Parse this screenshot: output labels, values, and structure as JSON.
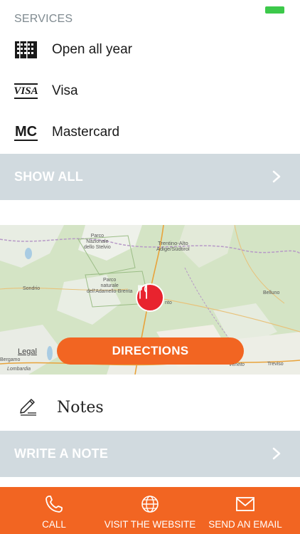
{
  "status_bar": {
    "battery_color": "#3cc94a"
  },
  "services": {
    "title": "SERVICES",
    "items": [
      {
        "icon": "calendar-icon",
        "label": "Open all year"
      },
      {
        "icon": "visa-icon",
        "label": "Visa",
        "icon_text": "VISA"
      },
      {
        "icon": "mastercard-icon",
        "label": "Mastercard",
        "icon_text": "MC"
      }
    ],
    "show_all_label": "SHOW ALL"
  },
  "map": {
    "labels": {
      "parco_stelvio": "Parco\nNazionale\ndello Stelvio",
      "trentino": "Trentino-Alto\nAdige/Südtirol",
      "sondrio": "Sondrio",
      "parco_adamello": "Parco\nnaturale\ndell'Adamello-Brenta",
      "belluno": "Belluno",
      "bergamo": "Bergamo",
      "lombardia": "Lombardia",
      "veneto": "Veneto",
      "treviso": "Treviso",
      "trento": "nto"
    },
    "legal_label": "Legal",
    "pin_icon": "restaurant-icon",
    "pin_color": "#e8232e",
    "directions_label": "DIRECTIONS"
  },
  "notes": {
    "title": "Notes",
    "write_label": "WRITE A NOTE"
  },
  "footer": {
    "call_label": "CALL",
    "website_label": "VISIT THE WEBSITE",
    "email_label": "SEND AN EMAIL"
  },
  "colors": {
    "accent": "#f26522",
    "bar_grey": "#d1dadf",
    "section_grey": "#7f8a90"
  }
}
